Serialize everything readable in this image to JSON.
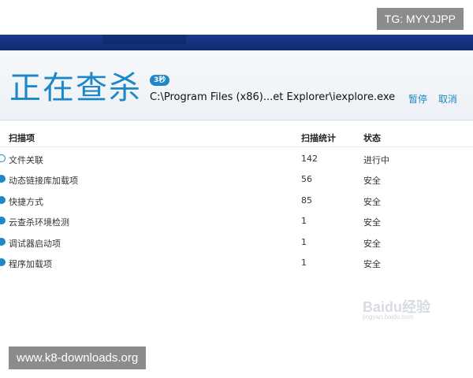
{
  "header": {
    "nav_tabs": [
      "",
      ""
    ],
    "title": "正在查杀",
    "time_badge": "3秒",
    "scan_path": "C:\\Program Files (x86)...et Explorer\\iexplore.exe",
    "pause_label": "暂停",
    "cancel_label": "取消"
  },
  "table": {
    "columns": [
      "扫描项",
      "扫描统计",
      "状态"
    ],
    "rows": [
      {
        "item": "文件关联",
        "count": "142",
        "status": "进行中",
        "icon": "spinner-icon"
      },
      {
        "item": "动态链接库加载项",
        "count": "56",
        "status": "安全",
        "icon": "check-icon"
      },
      {
        "item": "快捷方式",
        "count": "85",
        "status": "安全",
        "icon": "check-icon"
      },
      {
        "item": "云查杀环境检测",
        "count": "1",
        "status": "安全",
        "icon": "check-icon"
      },
      {
        "item": "调试器启动项",
        "count": "1",
        "status": "安全",
        "icon": "check-icon"
      },
      {
        "item": "程序加载项",
        "count": "1",
        "status": "安全",
        "icon": "check-icon"
      }
    ]
  },
  "overlays": {
    "top_watermark": "TG: MYYJJPP",
    "bottom_watermark": "www.k8-downloads.org",
    "baidu_logo": "Baidu经验",
    "baidu_sub": "jingyan.baidu.com"
  },
  "colors": {
    "accent": "#1d87c8",
    "nav": "#12307a"
  }
}
